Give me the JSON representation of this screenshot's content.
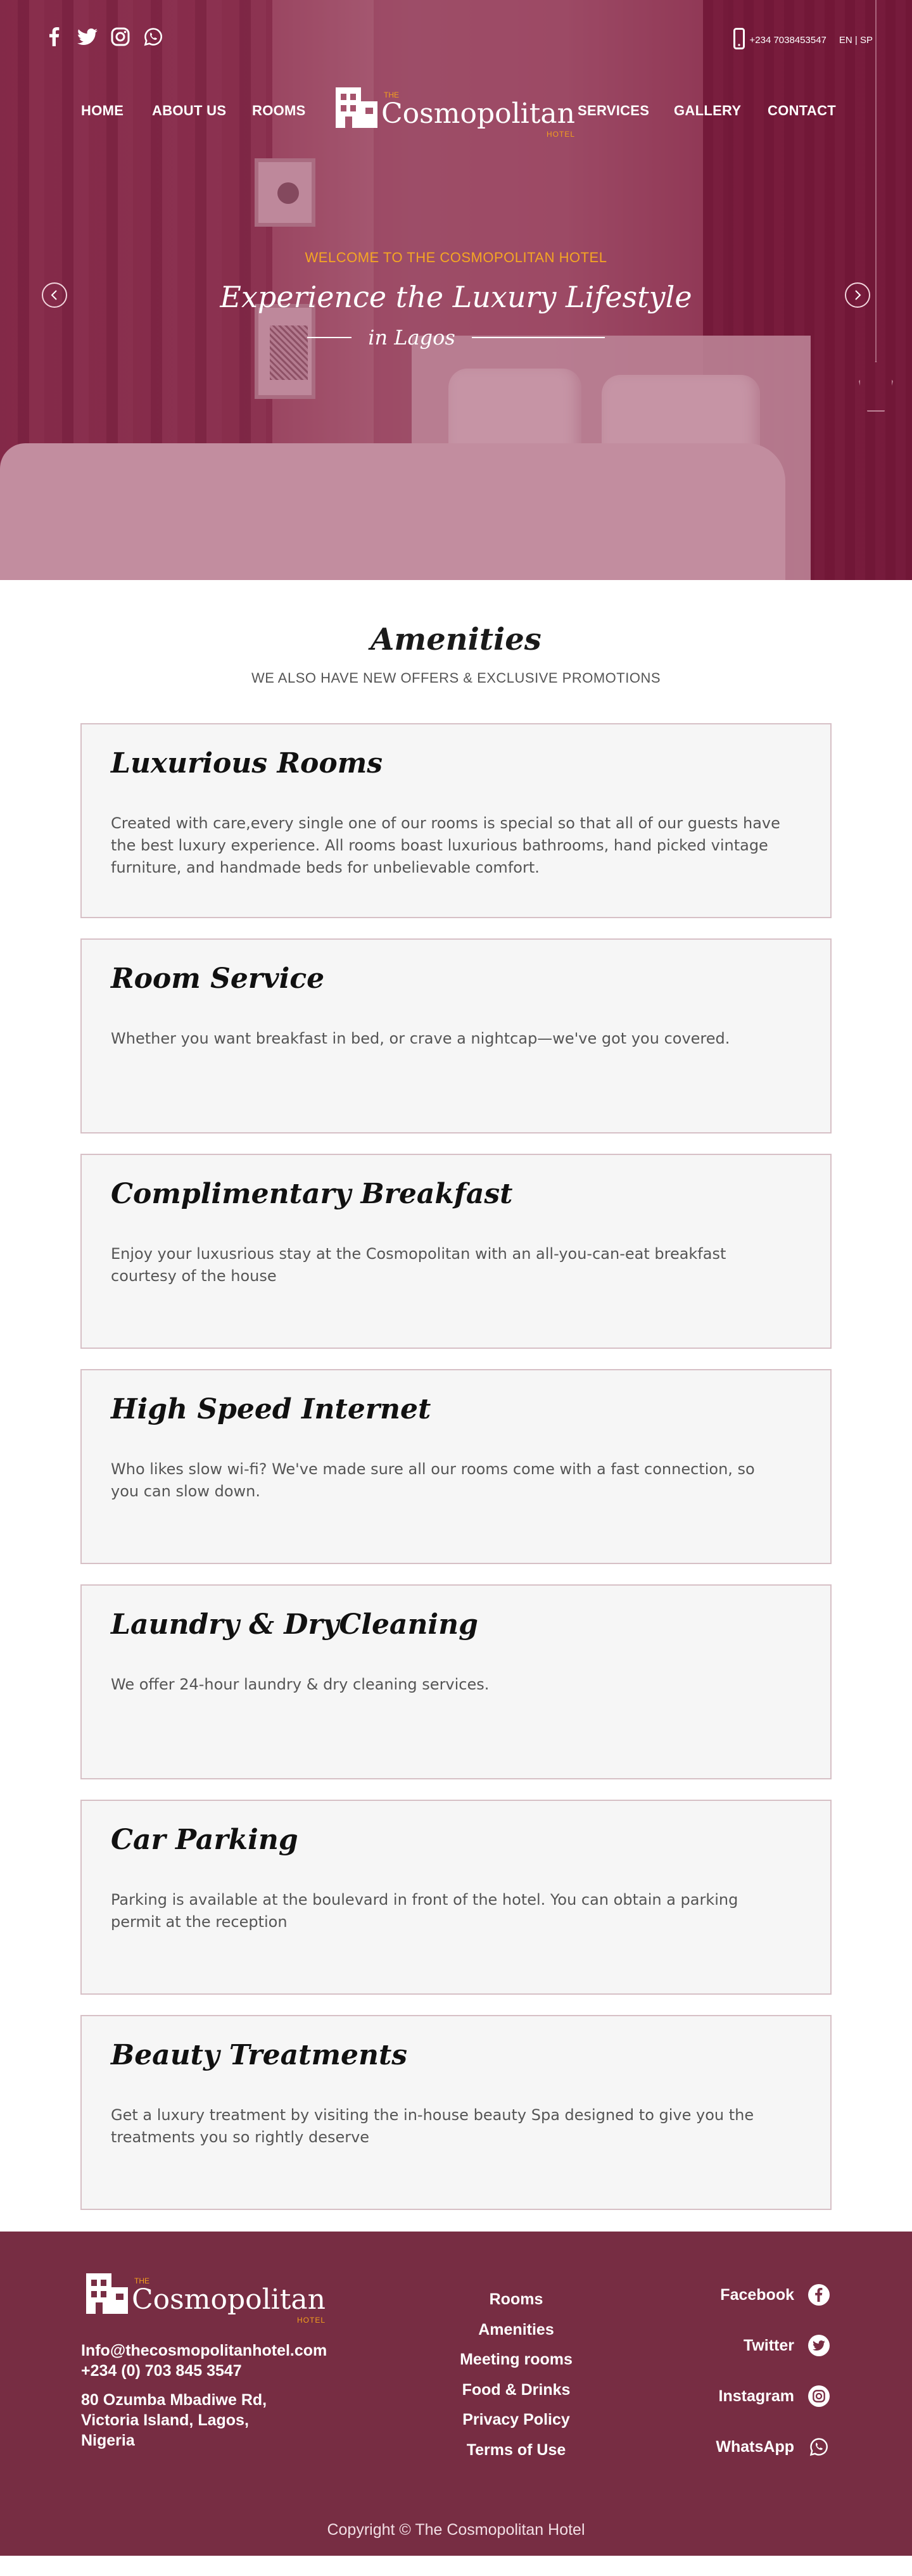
{
  "header": {
    "social": [
      {
        "name": "facebook-icon"
      },
      {
        "name": "twitter-icon"
      },
      {
        "name": "instagram-icon"
      },
      {
        "name": "whatsapp-icon"
      }
    ],
    "phone": "+234 7038453547",
    "language": "EN | SP",
    "brand": {
      "the": "THE",
      "name": "Cosmopolitan",
      "hotel": "HOTEL"
    },
    "nav": {
      "home": "HOME",
      "about": "ABOUT US",
      "rooms": "ROOMS",
      "services": "SERVICES",
      "gallery": "GALLERY",
      "contact": "CONTACT"
    }
  },
  "hero": {
    "welcome": "WELCOME TO THE COSMOPOLITAN HOTEL",
    "title": "Experience the Luxury Lifestyle",
    "subtitle": "in Lagos"
  },
  "amenities": {
    "title": "Amenities",
    "subtitle": "WE ALSO HAVE NEW OFFERS & EXCLUSIVE PROMOTIONS",
    "items": [
      {
        "title": "Luxurious Rooms",
        "text": "Created with care,every single one of our rooms is special so that all of our guests have the best luxury experience. All rooms boast luxurious bathrooms, hand picked vintage furniture, and handmade beds for unbelievable comfort."
      },
      {
        "title": "Room Service",
        "text": "Whether you want breakfast in bed, or crave a nightcap—we've got you covered."
      },
      {
        "title": "Complimentary Breakfast",
        "text": "Enjoy your luxusrious stay at the Cosmopolitan with an all-you-can-eat breakfast courtesy of the house"
      },
      {
        "title": "High Speed Internet",
        "text": "Who likes slow wi-fi? We've made sure all our rooms come with a fast connection, so you can slow down."
      },
      {
        "title": "Laundry & DryCleaning",
        "text": "We offer 24-hour laundry & dry cleaning services."
      },
      {
        "title": "Car Parking",
        "text": "Parking is available at the boulevard in front of the hotel. You can obtain a parking permit at the reception"
      },
      {
        "title": "Beauty Treatments",
        "text": "Get a luxury treatment by visiting the in-house beauty Spa designed to give you the treatments you so rightly deserve"
      }
    ]
  },
  "footer": {
    "email": "Info@thecosmopolitanhotel.com",
    "phone": "+234 (0) 703 845 3547",
    "address": [
      "80 Ozumba Mbadiwe Rd,",
      "Victoria Island, Lagos,",
      "Nigeria"
    ],
    "links": [
      "Rooms",
      "Amenities",
      "Meeting rooms",
      "Food & Drinks",
      "Privacy Policy",
      "Terms of Use"
    ],
    "social": [
      {
        "label": "Facebook",
        "icon": "facebook-icon"
      },
      {
        "label": "Twitter",
        "icon": "twitter-icon"
      },
      {
        "label": "Instagram",
        "icon": "instagram-icon"
      },
      {
        "label": "WhatsApp",
        "icon": "whatsapp-icon"
      }
    ],
    "copyright": "Copyright ©  The Cosmopolitan Hotel"
  },
  "colors": {
    "brand_maroon": "#772d43",
    "accent_orange": "#f5a623"
  }
}
